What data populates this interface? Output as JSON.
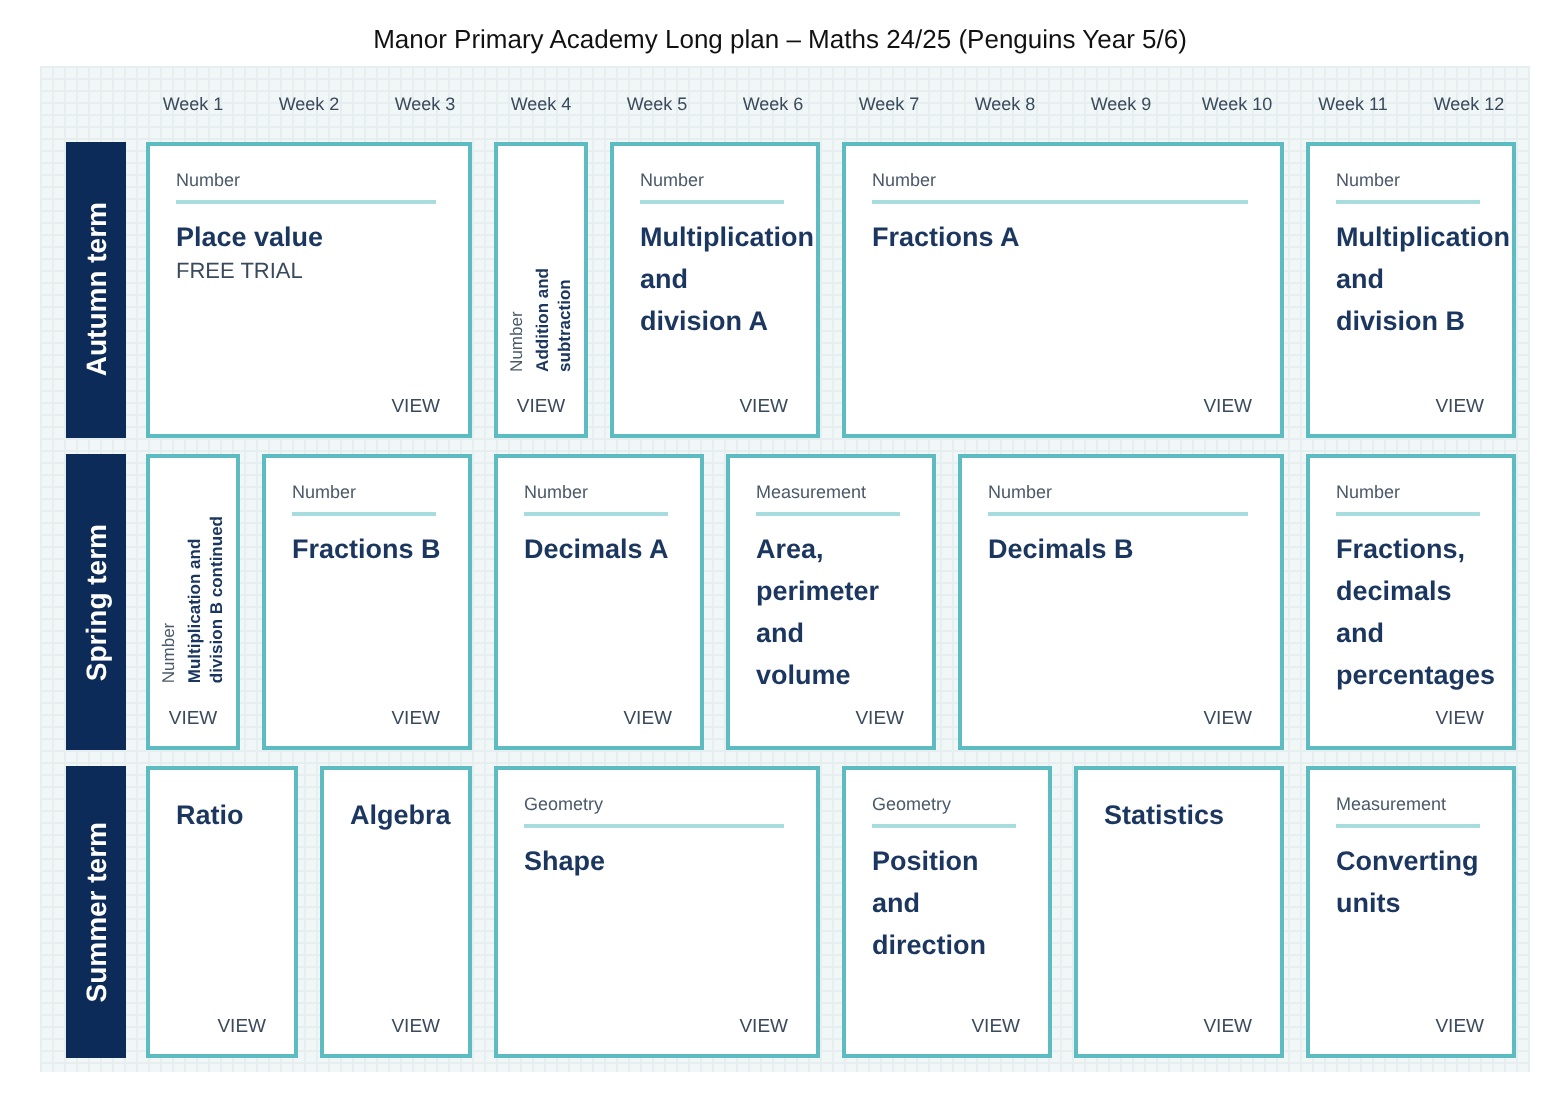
{
  "title": "Manor Primary Academy Long plan – Maths 24/25 (Penguins Year 5/6)",
  "weeks": [
    "Week 1",
    "Week 2",
    "Week 3",
    "Week 4",
    "Week 5",
    "Week 6",
    "Week 7",
    "Week 8",
    "Week 9",
    "Week 10",
    "Week 11",
    "Week 12"
  ],
  "terms": [
    {
      "name": "Autumn term",
      "units": [
        {
          "kind": "card",
          "category": "Number",
          "title": "Place value",
          "note": "FREE TRIAL",
          "action": "VIEW"
        },
        {
          "kind": "vertical",
          "category": "Number",
          "title": "Addition and\nsubtraction",
          "action": "VIEW"
        },
        {
          "kind": "card",
          "category": "Number",
          "title": "Multiplication\nand\ndivision A",
          "action": "VIEW"
        },
        {
          "kind": "card",
          "category": "Number",
          "title": "Fractions A",
          "action": "VIEW"
        },
        {
          "kind": "card",
          "category": "Number",
          "title": "Multiplication\nand\ndivision B",
          "action": "VIEW"
        }
      ]
    },
    {
      "name": "Spring term",
      "units": [
        {
          "kind": "vertical",
          "category": "Number",
          "title": "Multiplication and\ndivision B continued",
          "action": "VIEW"
        },
        {
          "kind": "card",
          "category": "Number",
          "title": "Fractions B",
          "action": "VIEW"
        },
        {
          "kind": "card",
          "category": "Number",
          "title": "Decimals A",
          "action": "VIEW"
        },
        {
          "kind": "card",
          "category": "Measurement",
          "title": "Area,\nperimeter\nand\nvolume",
          "action": "VIEW"
        },
        {
          "kind": "card",
          "category": "Number",
          "title": "Decimals B",
          "action": "VIEW"
        },
        {
          "kind": "card",
          "category": "Number",
          "title": "Fractions,\ndecimals\nand\npercentages",
          "action": "VIEW"
        }
      ]
    },
    {
      "name": "Summer term",
      "units": [
        {
          "kind": "card",
          "title": "Ratio",
          "action": "VIEW"
        },
        {
          "kind": "card",
          "title": "Algebra",
          "action": "VIEW"
        },
        {
          "kind": "card",
          "category": "Geometry",
          "title": "Shape",
          "action": "VIEW"
        },
        {
          "kind": "card",
          "category": "Geometry",
          "title": "Position\nand\ndirection",
          "action": "VIEW"
        },
        {
          "kind": "card",
          "title": "Statistics",
          "action": "VIEW"
        },
        {
          "kind": "card",
          "category": "Measurement",
          "title": "Converting\nunits",
          "action": "VIEW"
        }
      ]
    }
  ]
}
